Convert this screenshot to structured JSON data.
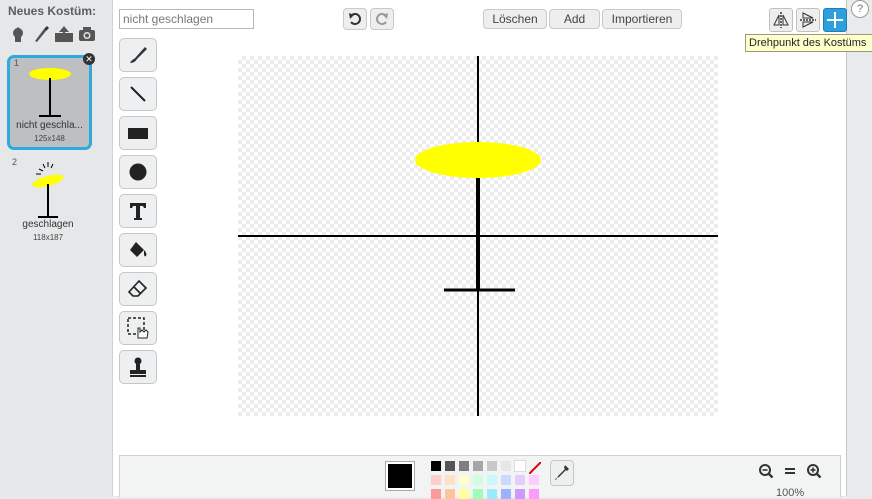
{
  "left_panel": {
    "title": "Neues Kostüm:",
    "costumes": [
      {
        "num": "1",
        "name": "nicht geschla...",
        "size": "125x148",
        "selected": true
      },
      {
        "num": "2",
        "name": "geschlagen",
        "size": "118x187",
        "selected": false
      }
    ]
  },
  "editor": {
    "costume_name_value": "nicht geschlagen",
    "buttons": {
      "clear": "Löschen",
      "add": "Add",
      "import": "Importieren"
    },
    "tooltip": "Drehpunkt des Kostüms",
    "help": "?"
  },
  "tools": [
    "brush",
    "line",
    "rectangle",
    "ellipse",
    "text",
    "fill",
    "eraser",
    "select",
    "stamp"
  ],
  "colors": {
    "selected_color": "#000000",
    "accent": "#2eaae0",
    "palette_row1": [
      "#000000",
      "#555555",
      "#7f7f7f",
      "#a6a6a6",
      "#c8c8c8",
      "#e6e6e6",
      "#ffffff"
    ],
    "palette_row2": [
      "#ffcccc",
      "#ffe0c8",
      "#ffffcc",
      "#ccffdd",
      "#ccf5ff",
      "#ccd9ff",
      "#e5ccff",
      "#ffccff"
    ],
    "palette_row3": [
      "#ff9999",
      "#ffc599",
      "#ffff99",
      "#99ffbb",
      "#99ecff",
      "#99b3ff",
      "#cc99ff",
      "#ff99ff"
    ]
  },
  "zoom": {
    "label": "100%"
  }
}
